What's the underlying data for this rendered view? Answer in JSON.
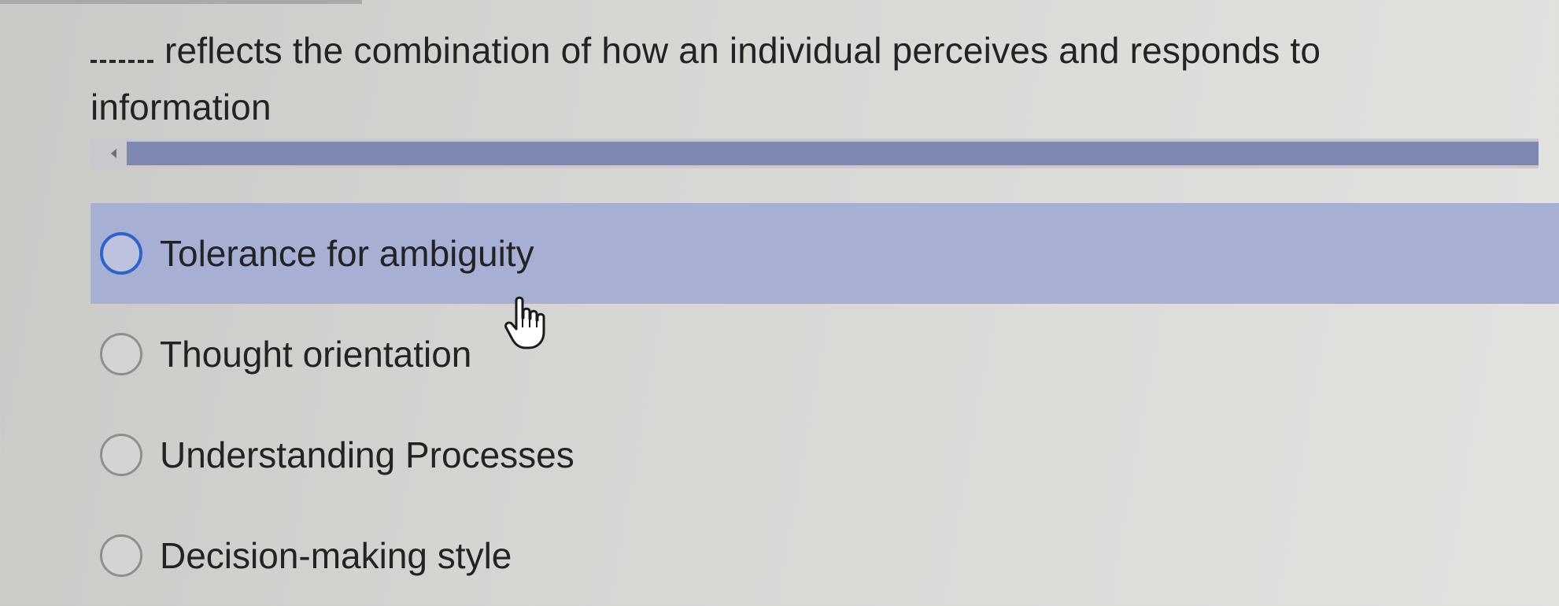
{
  "question": {
    "blank": "____",
    "text": "reflects the combination of how an individual perceives and responds to information"
  },
  "scrollbar": {
    "arrow_icon": "chevron-left-icon"
  },
  "options": [
    {
      "label": "Tolerance for ambiguity",
      "selected": false,
      "hovered": true
    },
    {
      "label": "Thought orientation",
      "selected": false,
      "hovered": false
    },
    {
      "label": "Understanding Processes",
      "selected": false,
      "hovered": false
    },
    {
      "label": "Decision-making style",
      "selected": false,
      "hovered": false
    }
  ],
  "colors": {
    "hover_highlight": "#a7afd4",
    "radio_focus": "#2f63c9",
    "scroll_thumb": "#7f88b3"
  },
  "cursor_icon": "hand-pointer-icon"
}
